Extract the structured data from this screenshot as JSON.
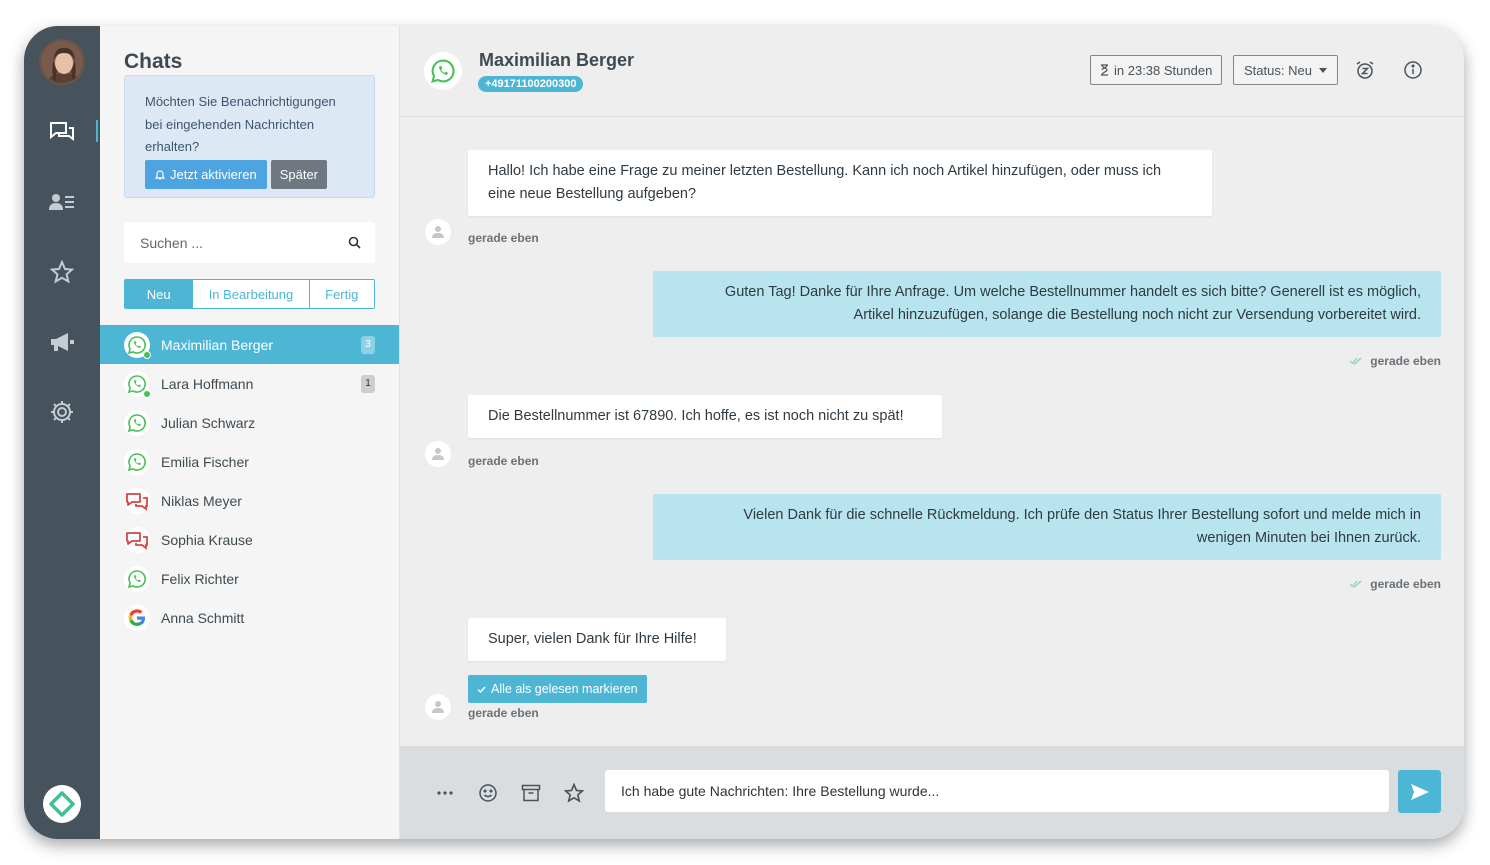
{
  "sidebar": {
    "avatar_alt": "user",
    "nav": [
      "chats-icon",
      "contacts-icon",
      "star-icon",
      "megaphone-icon",
      "gear-icon"
    ]
  },
  "chatlist": {
    "title": "Chats",
    "notification": {
      "text": "Möchten Sie Benachrichtigungen bei eingehenden Nachrichten erhalten?",
      "activate_label": "Jetzt aktivieren",
      "later_label": "Später"
    },
    "search_placeholder": "Suchen ...",
    "filters": [
      "Neu",
      "In Bearbeitung",
      "Fertig"
    ],
    "contacts": [
      {
        "name": "Maximilian Berger",
        "channel": "whatsapp",
        "badge": "3",
        "online": true
      },
      {
        "name": "Lara Hoffmann",
        "channel": "whatsapp",
        "badge": "1",
        "online": true
      },
      {
        "name": "Julian Schwarz",
        "channel": "whatsapp",
        "badge": "",
        "online": false
      },
      {
        "name": "Emilia Fischer",
        "channel": "whatsapp",
        "badge": "",
        "online": false
      },
      {
        "name": "Niklas Meyer",
        "channel": "chat",
        "badge": "",
        "online": false
      },
      {
        "name": "Sophia Krause",
        "channel": "chat",
        "badge": "",
        "online": false
      },
      {
        "name": "Felix Richter",
        "channel": "whatsapp",
        "badge": "",
        "online": false
      },
      {
        "name": "Anna Schmitt",
        "channel": "google",
        "badge": "",
        "online": false
      }
    ]
  },
  "conversation": {
    "name": "Maximilian Berger",
    "phone": "+49171100200300",
    "timer_label": "in 23:38 Stunden",
    "status_label": "Status: Neu",
    "messages": [
      {
        "dir": "in",
        "lines": [
          "Hallo! Ich habe eine Frage zu meiner letzten Bestellung. Kann ich noch Artikel hinzufügen, oder muss ich",
          "eine neue Bestellung aufgeben?"
        ],
        "time": "gerade eben"
      },
      {
        "dir": "out",
        "lines": [
          "Guten Tag! Danke für Ihre Anfrage. Um welche Bestellnummer handelt es sich bitte? Generell ist es möglich,",
          "Artikel hinzuzufügen, solange die Bestellung noch nicht zur Versendung vorbereitet wird."
        ],
        "time": "gerade eben"
      },
      {
        "dir": "in",
        "lines": [
          "Die Bestellnummer ist 67890. Ich hoffe, es ist noch nicht zu spät!"
        ],
        "time": "gerade eben"
      },
      {
        "dir": "out",
        "lines": [
          "Vielen Dank für die schnelle Rückmeldung. Ich prüfe den Status Ihrer Bestellung sofort und melde mich in",
          "wenigen Minuten bei Ihnen zurück."
        ],
        "time": "gerade eben"
      },
      {
        "dir": "in",
        "lines": [
          "Super, vielen Dank für Ihre Hilfe!"
        ],
        "time": "gerade eben"
      }
    ],
    "mark_read_label": "Alle als gelesen markieren"
  },
  "composer": {
    "value": "Ich habe gute Nachrichten: Ihre Bestellung wurde..."
  },
  "colors": {
    "accent": "#4db6d5",
    "rail": "#46535c",
    "outgoing": "#b7e4ef",
    "whatsapp": "#46c057"
  }
}
